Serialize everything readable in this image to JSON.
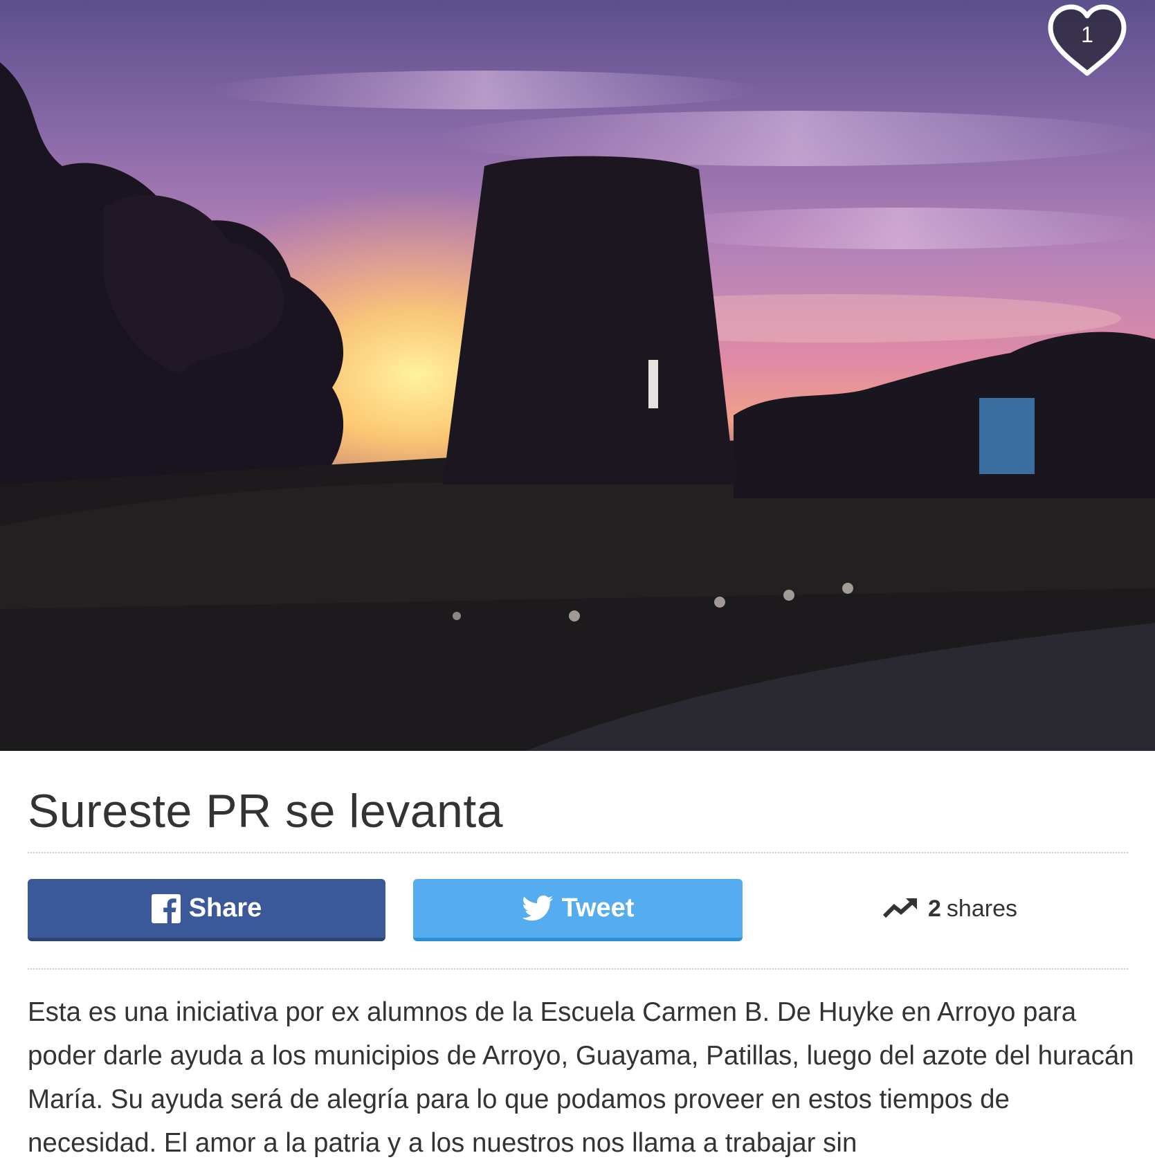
{
  "hero": {
    "image_alt": "Sunset behind a silhouetted stone windmill tower",
    "heart": {
      "count": "1",
      "icon": "heart-icon"
    }
  },
  "campaign": {
    "title": "Sureste PR se levanta"
  },
  "share_bar": {
    "facebook": {
      "label": "Share",
      "icon": "facebook-icon",
      "color": "#3b5998"
    },
    "twitter": {
      "label": "Tweet",
      "icon": "twitter-bird-icon",
      "color": "#55acee"
    },
    "shares": {
      "count": "2",
      "label": "shares",
      "icon": "trending-up-icon"
    }
  },
  "description": {
    "text": "Esta es una iniciativa por ex alumnos de la Escuela Carmen B. De Huyke en Arroyo para poder darle ayuda a los municipios de Arroyo, Guayama, Patillas, luego del azote del huracán María. Su ayuda será de alegría para lo que podamos proveer en estos tiempos de necesidad. El amor a la patria y a los nuestros nos llama a trabajar sin"
  }
}
